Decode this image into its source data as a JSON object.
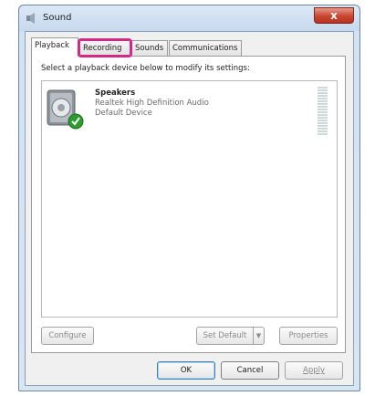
{
  "window": {
    "title": "Sound",
    "close_symbol": "x",
    "icon": "speaker-app-icon"
  },
  "tabs": [
    {
      "label": "Playback",
      "active": true
    },
    {
      "label": "Recording",
      "highlighted": true
    },
    {
      "label": "Sounds"
    },
    {
      "label": "Communications"
    }
  ],
  "panel": {
    "instruction": "Select a playback device below to modify its settings:"
  },
  "devices": [
    {
      "name": "Speakers",
      "driver": "Realtek High Definition Audio",
      "status": "Default Device",
      "icon": "speaker-icon",
      "badge": "default-check-icon"
    }
  ],
  "buttons": {
    "configure": "Configure",
    "set_default": "Set Default",
    "set_default_arrow": "▼",
    "properties": "Properties",
    "ok": "OK",
    "cancel": "Cancel",
    "apply": "Apply"
  },
  "colors": {
    "highlight": "#d12a86",
    "close_button": "#c7452e",
    "check_badge": "#2e9b2e"
  }
}
